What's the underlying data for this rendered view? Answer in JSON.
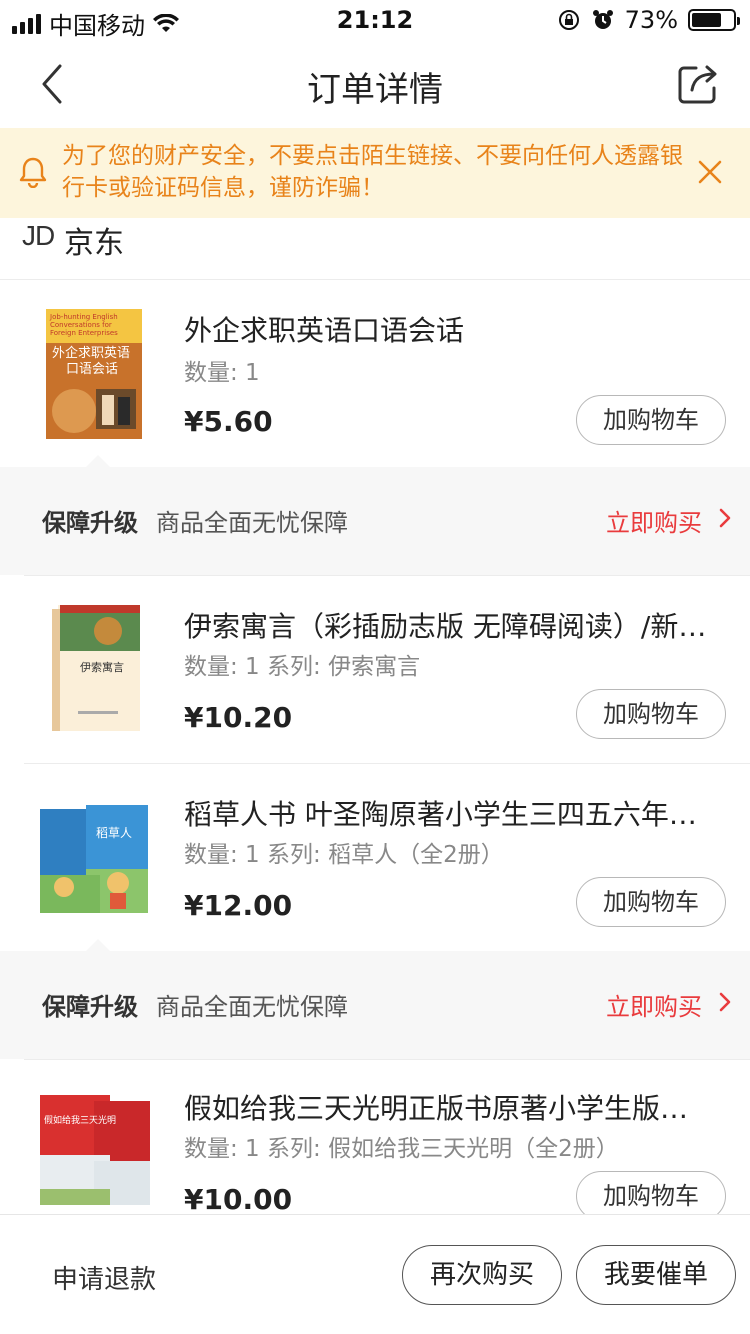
{
  "status_bar": {
    "carrier": "中国移动",
    "time": "21:12",
    "battery": "73%",
    "battery_level": 0.73
  },
  "nav": {
    "title": "订单详情",
    "back_icon": "chevron-left-icon",
    "share_icon": "share-icon"
  },
  "warning": {
    "text": "为了您的财产安全，不要点击陌生链接、不要向任何人透露银行卡或验证码信息，谨防诈骗！",
    "icon": "bell-icon",
    "close_icon": "close-icon",
    "color": "#e8831a",
    "background": "#fdf5dc"
  },
  "shop": {
    "logo": "JD",
    "name": "京东"
  },
  "products": [
    {
      "title": "外企求职英语口语会话",
      "meta": "数量: 1",
      "price": "¥5.60",
      "cart_label": "加购物车"
    },
    {
      "title": "伊索寓言（彩插励志版 无障碍阅读）/新…",
      "meta": "数量: 1 系列: 伊索寓言",
      "price": "¥10.20",
      "cart_label": "加购物车"
    },
    {
      "title": "稻草人书 叶圣陶原著小学生三四五六年…",
      "meta": "数量: 1 系列: 稻草人（全2册）",
      "price": "¥12.00",
      "cart_label": "加购物车"
    },
    {
      "title": "假如给我三天光明正版书原著小学生版…",
      "meta": "数量: 1 系列: 假如给我三天光明（全2册）",
      "price": "¥10.00",
      "cart_label": "加购物车"
    }
  ],
  "book_covers": {
    "book1_line1": "Job-hunting English",
    "book1_line2": "Conversations for",
    "book1_line3": "Foreign Enterprises",
    "book1_cn1": "外企求职英语",
    "book1_cn2": "口语会话",
    "book2_title": "伊索寓言",
    "book3_title": "稻草人",
    "book4_title": "假如给我三天光明"
  },
  "guarantees": [
    {
      "title": "保障升级",
      "desc": "商品全面无忧保障",
      "action": "立即购买"
    },
    {
      "title": "保障升级",
      "desc": "商品全面无忧保障",
      "action": "立即购买"
    }
  ],
  "bottom": {
    "refund": "申请退款",
    "rebuy": "再次购买",
    "urge": "我要催单"
  },
  "colors": {
    "accent_red": "#e93b3d",
    "text_primary": "#222222",
    "text_secondary": "#888888"
  }
}
